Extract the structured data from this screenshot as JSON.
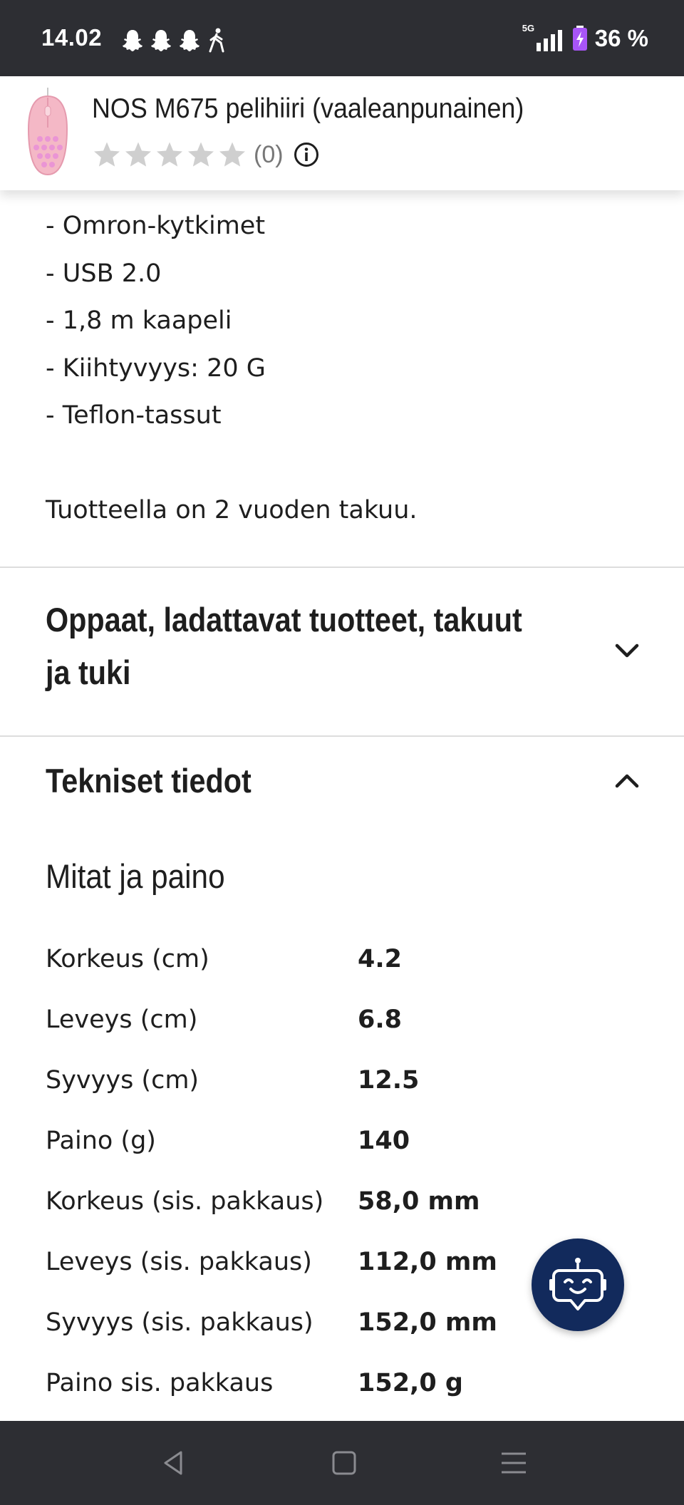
{
  "status_bar": {
    "time": "14.02",
    "network": "5G",
    "battery": "36 %",
    "icons": [
      "snapchat-icon",
      "snapchat-icon",
      "snapchat-icon",
      "walking-icon",
      "signal-icon",
      "battery-charging-icon"
    ]
  },
  "product_header": {
    "name": "NOS M675 pelihiiri (vaaleanpunainen)",
    "rating_stars": 0,
    "rating_max": 5,
    "review_count": "(0)"
  },
  "description": {
    "lines": [
      "- Omron-kytkimet",
      "- USB 2.0",
      "- 1,8 m kaapeli",
      "- Kiihtyvyys: 20 G",
      "- Teflon-tassut"
    ],
    "warranty": "Tuotteella on 2 vuoden takuu."
  },
  "accordions": {
    "guides": {
      "title": "Oppaat, ladattavat tuotteet, takuut ja tuki",
      "expanded": false
    },
    "specs": {
      "title": "Tekniset tiedot",
      "expanded": true
    }
  },
  "specs": {
    "group_title": "Mitat ja paino",
    "rows": [
      {
        "label": "Korkeus (cm)",
        "value": "4.2"
      },
      {
        "label": "Leveys (cm)",
        "value": "6.8"
      },
      {
        "label": "Syvyys (cm)",
        "value": "12.5"
      },
      {
        "label": "Paino (g)",
        "value": "140"
      },
      {
        "label": "Korkeus (sis. pakkaus)",
        "value": "58,0 mm"
      },
      {
        "label": "Leveys (sis. pakkaus)",
        "value": "112,0 mm"
      },
      {
        "label": "Syvyys (sis. pakkaus)",
        "value": "152,0 mm"
      },
      {
        "label": "Paino sis. pakkaus",
        "value": "152,0 g"
      }
    ]
  },
  "colors": {
    "status_bar": "#2d2e33",
    "chatbot": "#122a5c",
    "star_empty": "#cfcfcf",
    "battery_accent": "#a855f7"
  },
  "nav_bar": {
    "icons": [
      "back-icon",
      "home-icon",
      "recents-icon"
    ]
  }
}
